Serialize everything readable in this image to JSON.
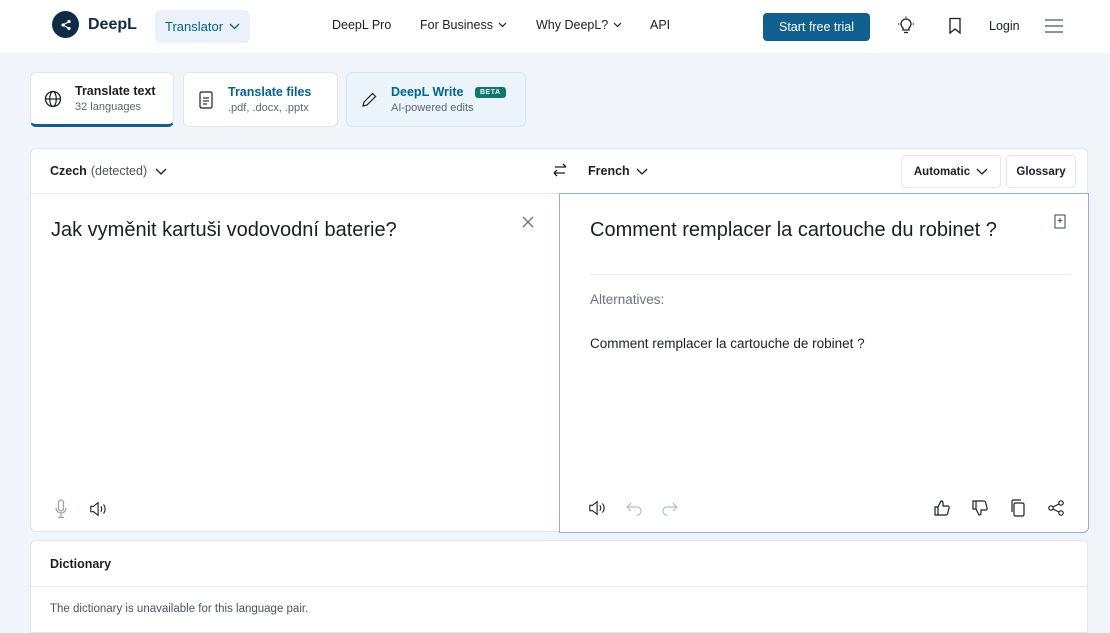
{
  "header": {
    "brand": "DeepL",
    "translator_label": "Translator",
    "nav": [
      {
        "label": "DeepL Pro"
      },
      {
        "label": "For Business"
      },
      {
        "label": "Why DeepL?"
      },
      {
        "label": "API"
      }
    ],
    "cta_label": "Start free trial",
    "login_label": "Login"
  },
  "mode_tabs": [
    {
      "title": "Translate text",
      "subtitle": "32 languages",
      "icon": "globe-icon",
      "active": true
    },
    {
      "title": "Translate files",
      "subtitle": ".pdf, .docx, .pptx",
      "icon": "document-icon",
      "active": false
    },
    {
      "title": "DeepL Write",
      "subtitle": "AI-powered edits",
      "badge": "BETA",
      "icon": "pen-icon",
      "active": false
    }
  ],
  "translator": {
    "source_lang": "Czech",
    "source_detected": "(detected)",
    "target_lang": "French",
    "formality_label": "Automatic",
    "glossary_label": "Glossary",
    "source_text": "Jak vyměnit kartuši vodovodní baterie?",
    "target_text": "Comment remplacer la cartouche du robinet ?",
    "alternatives_label": "Alternatives:",
    "alternatives": [
      "Comment remplacer la cartouche de robinet ?"
    ]
  },
  "dictionary": {
    "title": "Dictionary",
    "message": "The dictionary is unavailable for this language pair."
  },
  "colors": {
    "brand_dark": "#0f2b46",
    "accent": "#0f5f8f",
    "link": "#006494",
    "beta_badge": "#0b7a6b",
    "page_bg": "#f1f4f8"
  }
}
